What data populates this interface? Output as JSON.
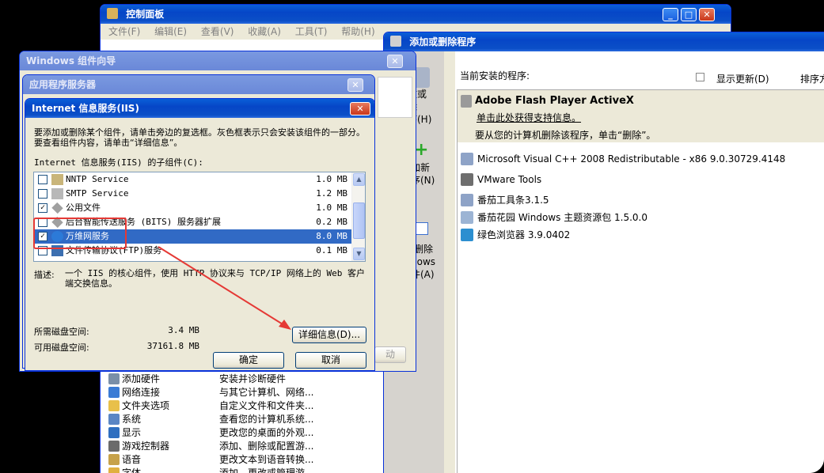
{
  "control_panel": {
    "title": "控制面板",
    "menu": [
      "文件(F)",
      "编辑(E)",
      "查看(V)",
      "收藏(A)",
      "工具(T)",
      "帮助(H)"
    ],
    "items": [
      {
        "name": "添加硬件",
        "desc": "安装并诊断硬件"
      },
      {
        "name": "网络连接",
        "desc": "与其它计算机、网络..."
      },
      {
        "name": "文件夹选项",
        "desc": "自定义文件和文件夹..."
      },
      {
        "name": "系统",
        "desc": "查看您的计算机系统..."
      },
      {
        "name": "显示",
        "desc": "更改您的桌面的外观..."
      },
      {
        "name": "游戏控制器",
        "desc": "添加、删除或配置游..."
      },
      {
        "name": "语音",
        "desc": "更改文本到语音转换..."
      },
      {
        "name": "字体",
        "desc": "添加、更改或管理游..."
      }
    ]
  },
  "arp": {
    "title": "添加或删除程序",
    "current_label": "当前安装的程序:",
    "show_updates": "显示更新(D)",
    "sort_label": "排序方",
    "sidebar": {
      "change_remove": "改或\n除\n序(H)",
      "add_new": "加新\n序(N)",
      "add_remove_windows": "/删除\ndows\n件(A)"
    },
    "selected_program": {
      "name": "Adobe Flash Player ActiveX",
      "support_link": "单击此处获得支持信息。",
      "remove_hint": "要从您的计算机删除该程序，单击“删除”。"
    },
    "programs": [
      "Microsoft Visual C++ 2008 Redistributable - x86 9.0.30729.4148",
      "VMware Tools",
      "番茄工具条3.1.5",
      "番茄花园 Windows 主题资源包 1.5.0.0",
      "绿色浏览器 3.9.0402"
    ]
  },
  "wizard": {
    "title": "Windows 组件向导"
  },
  "app_server": {
    "title": "应用程序服务器",
    "next_button_partial": "动"
  },
  "iis": {
    "title": "Internet 信息服务(IIS)",
    "instruction": "要添加或删除某个组件，请单击旁边的复选框。灰色框表示只会安装该组件的一部分。要查看组件内容，请单击“详细信息”。",
    "subcomponents_label": "Internet 信息服务(IIS) 的子组件(C):",
    "components": [
      {
        "name": "NNTP Service",
        "size": "1.0 MB",
        "checked": false
      },
      {
        "name": "SMTP Service",
        "size": "1.2 MB",
        "checked": false
      },
      {
        "name": "公用文件",
        "size": "1.0 MB",
        "checked": true
      },
      {
        "name": "后台智能传送服务 (BITS) 服务器扩展",
        "size": "0.2 MB",
        "checked": false
      },
      {
        "name": "万维网服务",
        "size": "8.0 MB",
        "checked": true
      },
      {
        "name": "文件传输协议(FTP)服务",
        "size": "0.1 MB",
        "checked": false
      }
    ],
    "description_label": "描述:",
    "description": "一个 IIS 的核心组件，使用 HTTP 协议来与 TCP/IP 网络上的 Web 客户端交换信息。",
    "disk_required_label": "所需磁盘空间:",
    "disk_required": "3.4 MB",
    "disk_available_label": "可用磁盘空间:",
    "disk_available": "37161.8 MB",
    "details_button": "详细信息(D)...",
    "ok_button": "确定",
    "cancel_button": "取消"
  },
  "colors": {
    "titlebar": "#0a5fd8",
    "selection": "#316ac5",
    "annotation": "#e53935"
  }
}
